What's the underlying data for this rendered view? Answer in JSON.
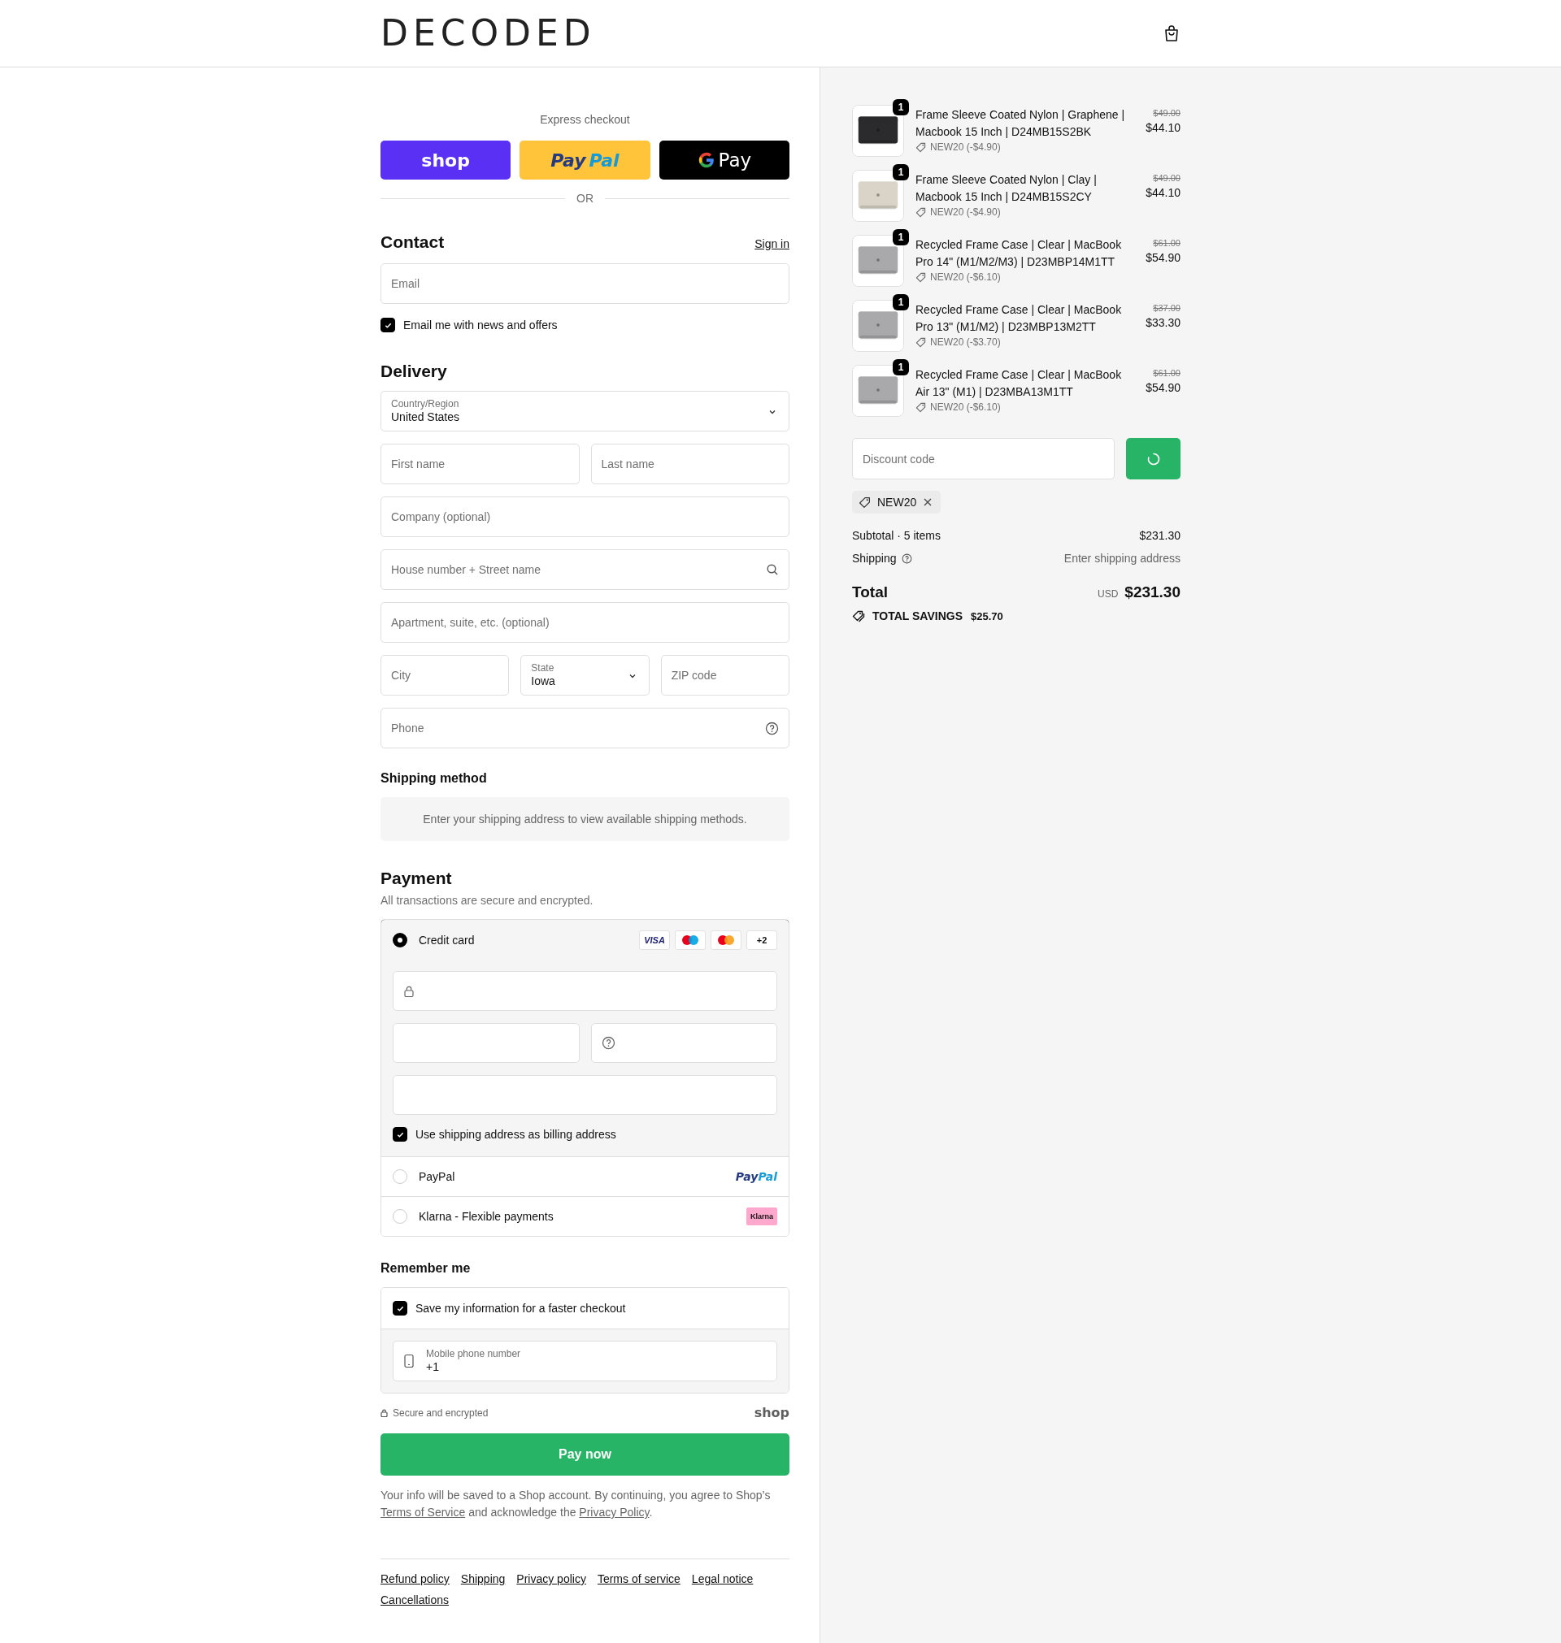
{
  "header": {
    "logo": "DECODED"
  },
  "express": {
    "title": "Express checkout",
    "buttons": [
      {
        "kind": "shop",
        "parts": [
          "shop"
        ]
      },
      {
        "kind": "paypal",
        "parts": [
          "Pay",
          "Pal"
        ]
      },
      {
        "kind": "gpay",
        "parts": [
          "Pay"
        ]
      }
    ],
    "divider": "OR"
  },
  "contact": {
    "title": "Contact",
    "link": "Sign in",
    "email": {
      "placeholder": "Email"
    },
    "newsletter": {
      "label": "Email me with news and offers",
      "checked": true
    }
  },
  "delivery": {
    "title": "Delivery",
    "rows": [
      {
        "fields": [
          {
            "kind": "select",
            "label": "Country/Region",
            "value": "United States"
          }
        ]
      },
      {
        "fields": [
          {
            "kind": "input",
            "placeholder": "First name"
          },
          {
            "kind": "input",
            "placeholder": "Last name"
          }
        ]
      },
      {
        "fields": [
          {
            "kind": "input",
            "placeholder": "Company (optional)"
          }
        ]
      },
      {
        "fields": [
          {
            "kind": "search",
            "placeholder": "House number + Street name"
          }
        ]
      },
      {
        "fields": [
          {
            "kind": "input",
            "placeholder": "Apartment, suite, etc. (optional)"
          }
        ]
      },
      {
        "fields": [
          {
            "kind": "input",
            "placeholder": "City"
          },
          {
            "kind": "select",
            "label": "State",
            "value": "Iowa"
          },
          {
            "kind": "input",
            "placeholder": "ZIP code"
          }
        ]
      },
      {
        "fields": [
          {
            "kind": "help",
            "placeholder": "Phone"
          }
        ]
      }
    ]
  },
  "shipping_method": {
    "title": "Shipping method",
    "notice": "Enter your shipping address to view available shipping methods."
  },
  "payment": {
    "title": "Payment",
    "subtitle": "All transactions are secure and encrypted.",
    "methods": [
      {
        "kind": "card",
        "label": "Credit card",
        "selected": true,
        "badges": [
          {
            "kind": "visa",
            "text": "VISA"
          },
          {
            "kind": "maestro"
          },
          {
            "kind": "mastercard"
          },
          {
            "kind": "more",
            "text": "+2"
          }
        ],
        "card_rows": [
          {
            "fields": [
              {
                "kind": "lock"
              }
            ]
          },
          {
            "fields": [
              {
                "kind": "plain"
              },
              {
                "kind": "help"
              }
            ]
          },
          {
            "fields": [
              {
                "kind": "plain"
              }
            ]
          }
        ],
        "billing": {
          "label": "Use shipping address as billing address",
          "checked": true
        }
      },
      {
        "kind": "paypal",
        "label": "PayPal",
        "selected": false,
        "logo_parts": [
          "Pay",
          "Pal"
        ]
      },
      {
        "kind": "klarna",
        "label": "Klarna - Flexible payments",
        "selected": false,
        "logo": "Klarna"
      }
    ]
  },
  "remember": {
    "title": "Remember me",
    "save": {
      "label": "Save my information for a faster checkout",
      "checked": true
    },
    "phone": {
      "label": "Mobile phone number",
      "value": "+1"
    }
  },
  "secure": {
    "text": "Secure and encrypted",
    "brand": "shop"
  },
  "pay_button": "Pay now",
  "legal": {
    "text": "Your info will be saved to a Shop account. By continuing, you agree to Shop’s",
    "link_1": "Terms of Service",
    "middle": "and acknowledge the",
    "link_2": "Privacy Policy",
    "end": "."
  },
  "footer_links": [
    "Refund policy",
    "Shipping",
    "Privacy policy",
    "Terms of service",
    "Legal notice",
    "Cancellations"
  ],
  "summary": {
    "items": [
      {
        "name": "Frame Sleeve Coated Nylon | Graphene | Macbook 15 Inch | D24MB15S2BK",
        "quantity": "1",
        "discount": "NEW20 (-$4.90)",
        "original_price": "$49.00",
        "price": "$44.10",
        "color": "#2b2b2d"
      },
      {
        "name": "Frame Sleeve Coated Nylon | Clay | Macbook 15 Inch | D24MB15S2CY",
        "quantity": "1",
        "discount": "NEW20 (-$4.90)",
        "original_price": "$49.00",
        "price": "$44.10",
        "color": "#d9d4c7"
      },
      {
        "name": "Recycled Frame Case | Clear | MacBook Pro 14\" (M1/M2/M3) | D23MBP14M1TT",
        "quantity": "1",
        "discount": "NEW20 (-$6.10)",
        "original_price": "$61.00",
        "price": "$54.90",
        "color": "#a9a9ab"
      },
      {
        "name": "Recycled Frame Case | Clear | MacBook Pro 13\" (M1/M2) | D23MBP13M2TT",
        "quantity": "1",
        "discount": "NEW20 (-$3.70)",
        "original_price": "$37.00",
        "price": "$33.30",
        "color": "#a9a9ab"
      },
      {
        "name": "Recycled Frame Case | Clear | MacBook Air 13\" (M1) | D23MBA13M1TT",
        "quantity": "1",
        "discount": "NEW20 (-$6.10)",
        "original_price": "$61.00",
        "price": "$54.90",
        "color": "#a9a9ab"
      }
    ],
    "discount_field": {
      "placeholder": "Discount code"
    },
    "applied_code": "NEW20",
    "subtotal": {
      "label": "Subtotal · 5 items",
      "value": "$231.30"
    },
    "shipping": {
      "label": "Shipping",
      "value": "Enter shipping address"
    },
    "total": {
      "label": "Total",
      "currency": "USD",
      "value": "$231.30"
    },
    "savings": {
      "label": "TOTAL SAVINGS",
      "value": "$25.70"
    }
  }
}
